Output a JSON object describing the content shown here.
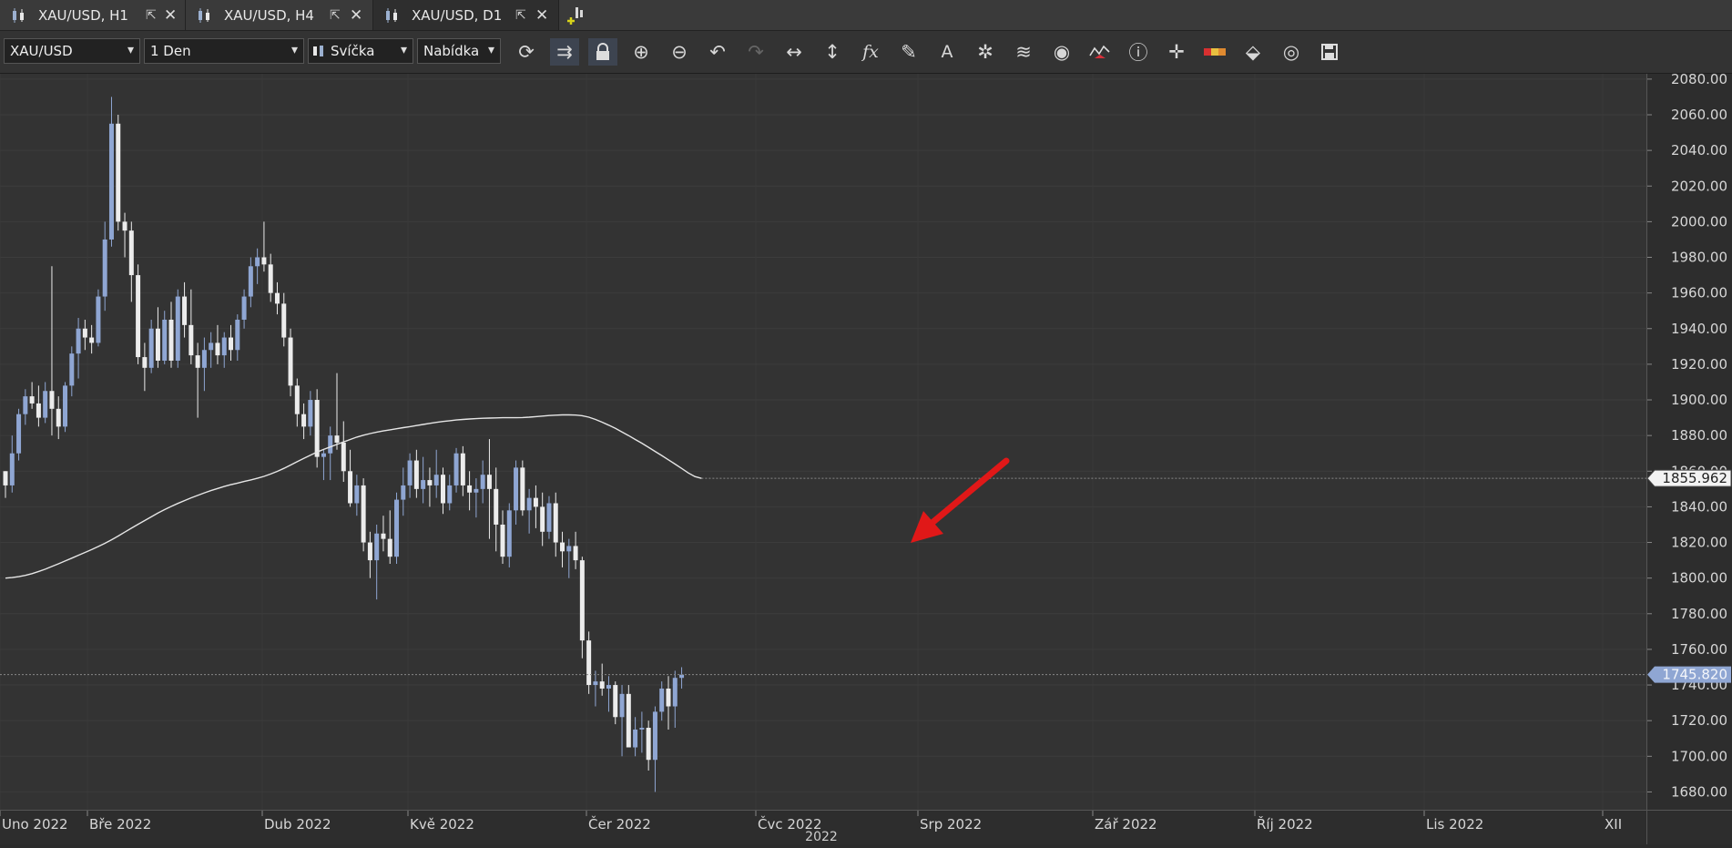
{
  "tabs": [
    {
      "label": "XAU/USD, H1"
    },
    {
      "label": "XAU/USD, H4"
    },
    {
      "label": "XAU/USD, D1",
      "active": true
    }
  ],
  "toolbar": {
    "symbol": "XAU/USD",
    "period": "1 Den",
    "chart_type": "Svíčka",
    "price_type": "Nabídka",
    "icons": [
      "refresh-icon",
      "auto-scroll-icon",
      "lock-icon",
      "zoom-in-icon",
      "zoom-out-icon",
      "undo-icon",
      "redo-icon",
      "horizontal-scale-icon",
      "vertical-scale-icon",
      "indicators-fx-icon",
      "pencil-icon",
      "text-tool-icon",
      "objects-icon",
      "layers-icon",
      "eye-icon",
      "chart-compare-icon",
      "info-icon",
      "crosshair-icon",
      "color-scheme-icon",
      "paint-bucket-icon",
      "reset-icon",
      "save-icon"
    ]
  },
  "chart_data": {
    "type": "candlestick",
    "symbol": "XAU/USD",
    "timeframe": "D1",
    "ylim": [
      1670,
      2083
    ],
    "y_ticks": [
      "2080.00",
      "2060.00",
      "2040.00",
      "2020.00",
      "2000.00",
      "1980.00",
      "1960.00",
      "1940.00",
      "1920.00",
      "1900.00",
      "1880.00",
      "1860.00",
      "1840.00",
      "1820.00",
      "1800.00",
      "1780.00",
      "1760.00",
      "1740.00",
      "1720.00",
      "1700.00",
      "1680.00"
    ],
    "x_labels": [
      "Uno 2022",
      "Bře 2022",
      "Dub 2022",
      "Kvě 2022",
      "Čer 2022",
      "Čvc 2022",
      "Srp 2022",
      "Zář 2022",
      "Říj 2022",
      "Lis 2022",
      "XII"
    ],
    "year_label": "2022",
    "current_price": "1745.820",
    "ma_value": "1855.962",
    "candles": [
      [
        1860,
        1860,
        1845,
        1852
      ],
      [
        1852,
        1880,
        1848,
        1870
      ],
      [
        1870,
        1895,
        1866,
        1892
      ],
      [
        1892,
        1906,
        1886,
        1902
      ],
      [
        1902,
        1910,
        1895,
        1898
      ],
      [
        1898,
        1908,
        1885,
        1890
      ],
      [
        1890,
        1910,
        1887,
        1905
      ],
      [
        1905,
        1975,
        1880,
        1895
      ],
      [
        1895,
        1902,
        1878,
        1885
      ],
      [
        1885,
        1910,
        1882,
        1908
      ],
      [
        1908,
        1930,
        1902,
        1926
      ],
      [
        1926,
        1946,
        1912,
        1940
      ],
      [
        1940,
        1945,
        1928,
        1935
      ],
      [
        1935,
        1942,
        1926,
        1932
      ],
      [
        1932,
        1962,
        1930,
        1958
      ],
      [
        1958,
        2000,
        1950,
        1990
      ],
      [
        1990,
        2070,
        1986,
        2055
      ],
      [
        2055,
        2060,
        1995,
        2000
      ],
      [
        2000,
        2005,
        1980,
        1995
      ],
      [
        1995,
        2000,
        1955,
        1970
      ],
      [
        1970,
        1976,
        1920,
        1924
      ],
      [
        1924,
        1932,
        1905,
        1918
      ],
      [
        1918,
        1945,
        1915,
        1940
      ],
      [
        1940,
        1952,
        1918,
        1922
      ],
      [
        1922,
        1950,
        1920,
        1945
      ],
      [
        1945,
        1955,
        1918,
        1922
      ],
      [
        1922,
        1962,
        1918,
        1958
      ],
      [
        1958,
        1966,
        1935,
        1942
      ],
      [
        1942,
        1962,
        1920,
        1925
      ],
      [
        1925,
        1932,
        1890,
        1918
      ],
      [
        1918,
        1935,
        1905,
        1928
      ],
      [
        1928,
        1938,
        1918,
        1932
      ],
      [
        1932,
        1942,
        1920,
        1925
      ],
      [
        1925,
        1938,
        1918,
        1935
      ],
      [
        1935,
        1942,
        1922,
        1928
      ],
      [
        1928,
        1948,
        1922,
        1945
      ],
      [
        1945,
        1962,
        1940,
        1958
      ],
      [
        1958,
        1980,
        1952,
        1975
      ],
      [
        1975,
        1985,
        1965,
        1980
      ],
      [
        1980,
        2000,
        1972,
        1976
      ],
      [
        1976,
        1982,
        1955,
        1960
      ],
      [
        1960,
        1966,
        1948,
        1954
      ],
      [
        1954,
        1960,
        1930,
        1935
      ],
      [
        1935,
        1940,
        1902,
        1908
      ],
      [
        1908,
        1912,
        1885,
        1892
      ],
      [
        1892,
        1898,
        1878,
        1885
      ],
      [
        1885,
        1905,
        1880,
        1900
      ],
      [
        1900,
        1906,
        1862,
        1868
      ],
      [
        1868,
        1872,
        1855,
        1870
      ],
      [
        1870,
        1885,
        1855,
        1880
      ],
      [
        1880,
        1915,
        1872,
        1876
      ],
      [
        1876,
        1888,
        1854,
        1860
      ],
      [
        1860,
        1872,
        1840,
        1842
      ],
      [
        1842,
        1858,
        1835,
        1852
      ],
      [
        1852,
        1856,
        1815,
        1820
      ],
      [
        1820,
        1826,
        1800,
        1810
      ],
      [
        1810,
        1830,
        1788,
        1825
      ],
      [
        1825,
        1835,
        1815,
        1822
      ],
      [
        1822,
        1838,
        1808,
        1812
      ],
      [
        1812,
        1848,
        1808,
        1844
      ],
      [
        1844,
        1862,
        1835,
        1852
      ],
      [
        1852,
        1870,
        1845,
        1866
      ],
      [
        1866,
        1872,
        1845,
        1850
      ],
      [
        1850,
        1868,
        1842,
        1855
      ],
      [
        1855,
        1862,
        1840,
        1852
      ],
      [
        1852,
        1872,
        1845,
        1858
      ],
      [
        1858,
        1862,
        1836,
        1842
      ],
      [
        1842,
        1858,
        1838,
        1852
      ],
      [
        1852,
        1873,
        1848,
        1870
      ],
      [
        1870,
        1874,
        1846,
        1852
      ],
      [
        1852,
        1860,
        1838,
        1848
      ],
      [
        1848,
        1856,
        1834,
        1850
      ],
      [
        1850,
        1866,
        1842,
        1858
      ],
      [
        1858,
        1878,
        1822,
        1850
      ],
      [
        1850,
        1862,
        1815,
        1830
      ],
      [
        1830,
        1838,
        1808,
        1812
      ],
      [
        1812,
        1842,
        1806,
        1838
      ],
      [
        1838,
        1866,
        1830,
        1862
      ],
      [
        1862,
        1866,
        1835,
        1838
      ],
      [
        1838,
        1850,
        1825,
        1845
      ],
      [
        1845,
        1852,
        1828,
        1840
      ],
      [
        1840,
        1848,
        1818,
        1826
      ],
      [
        1826,
        1846,
        1822,
        1842
      ],
      [
        1842,
        1848,
        1812,
        1820
      ],
      [
        1820,
        1826,
        1806,
        1815
      ],
      [
        1815,
        1822,
        1800,
        1818
      ],
      [
        1818,
        1826,
        1805,
        1810
      ],
      [
        1810,
        1812,
        1755,
        1765
      ],
      [
        1765,
        1770,
        1735,
        1740
      ],
      [
        1740,
        1748,
        1728,
        1742
      ],
      [
        1742,
        1752,
        1734,
        1738
      ],
      [
        1738,
        1745,
        1725,
        1740
      ],
      [
        1740,
        1742,
        1718,
        1722
      ],
      [
        1722,
        1740,
        1700,
        1735
      ],
      [
        1735,
        1740,
        1712,
        1705
      ],
      [
        1705,
        1722,
        1700,
        1715
      ],
      [
        1715,
        1725,
        1702,
        1716
      ],
      [
        1716,
        1720,
        1692,
        1698
      ],
      [
        1698,
        1728,
        1680,
        1725
      ],
      [
        1725,
        1742,
        1720,
        1738
      ],
      [
        1738,
        1745,
        1715,
        1728
      ],
      [
        1728,
        1748,
        1716,
        1744
      ],
      [
        1744,
        1750,
        1738,
        1745.82
      ]
    ],
    "ma_series": [
      1800,
      1800.3,
      1800.8,
      1801.5,
      1802.5,
      1803.7,
      1805,
      1806.5,
      1808,
      1809.6,
      1811.2,
      1812.8,
      1814.4,
      1816,
      1817.7,
      1819.5,
      1821.5,
      1823.6,
      1825.8,
      1828,
      1830.2,
      1832.3,
      1834.4,
      1836.5,
      1838.4,
      1840.2,
      1841.9,
      1843.5,
      1845,
      1846.4,
      1847.8,
      1849.1,
      1850.3,
      1851.4,
      1852.4,
      1853.3,
      1854.2,
      1855.1,
      1856,
      1857.1,
      1858.4,
      1859.9,
      1861.6,
      1863.4,
      1865.3,
      1867.2,
      1869,
      1870.7,
      1872.2,
      1873.6,
      1875,
      1876.4,
      1877.8,
      1879.1,
      1880.2,
      1881.1,
      1881.9,
      1882.6,
      1883.2,
      1883.8,
      1884.4,
      1885,
      1885.6,
      1886.2,
      1886.8,
      1887.4,
      1887.9,
      1888.3,
      1888.7,
      1889,
      1889.3,
      1889.5,
      1889.7,
      1889.8,
      1889.9,
      1890,
      1890,
      1890,
      1890.1,
      1890.3,
      1890.6,
      1890.9,
      1891.2,
      1891.4,
      1891.6,
      1891.6,
      1891.5,
      1891.1,
      1890.3,
      1889,
      1887.5,
      1885.8,
      1884,
      1882,
      1880,
      1877.8,
      1875.7,
      1873.4,
      1871.1,
      1868.8,
      1866.4,
      1864,
      1861.5,
      1859,
      1857,
      1855.962
    ]
  }
}
